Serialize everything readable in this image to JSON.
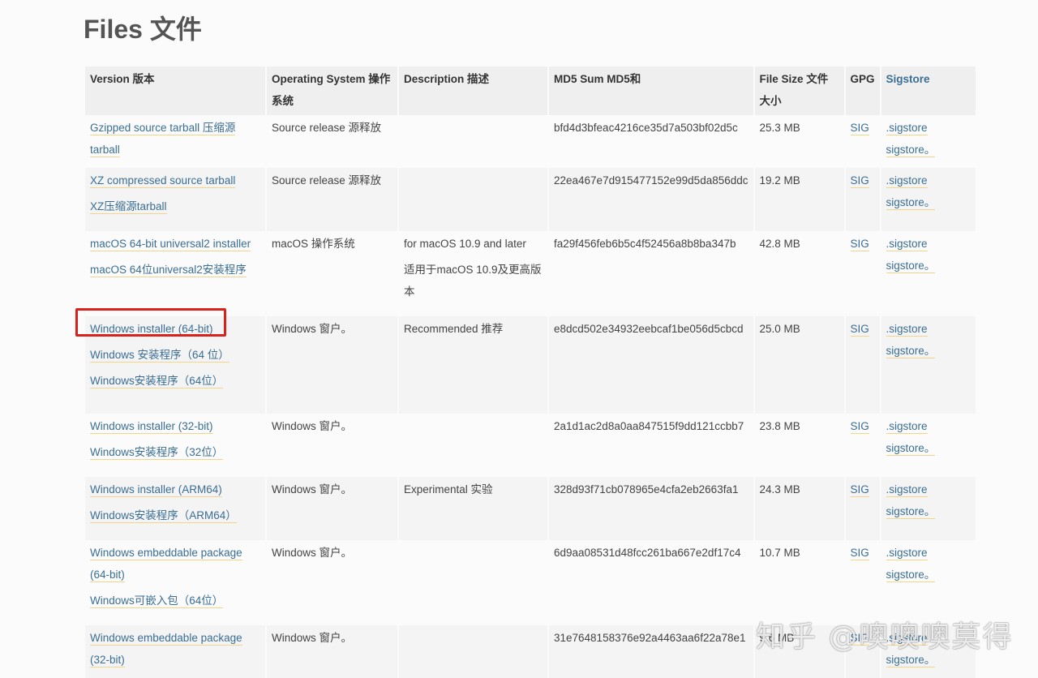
{
  "page": {
    "title": "Files  文件"
  },
  "table": {
    "headers": {
      "version": "Version 版本",
      "os": "Operating System 操作系统",
      "description": "Description 描述",
      "md5": "MD5 Sum MD5和",
      "size": "File Size 文件大小",
      "gpg": "GPG",
      "sigstore": "Sigstore"
    },
    "rows": [
      {
        "version": [
          "Gzipped source tarball 压缩源tarball"
        ],
        "os": "Source release 源释放",
        "description": [],
        "md5": "bfd4d3bfeac4216ce35d7a503bf02d5c",
        "size": "25.3 MB",
        "gpg": "SIG",
        "sigstore": [
          ".sigstore",
          "sigstore。"
        ]
      },
      {
        "version": [
          "XZ compressed source tarball",
          "XZ压缩源tarball"
        ],
        "os": "Source release 源释放",
        "description": [],
        "md5": "22ea467e7d915477152e99d5da856ddc",
        "size": "19.2 MB",
        "gpg": "SIG",
        "sigstore": [
          ".sigstore",
          "sigstore。"
        ]
      },
      {
        "version": [
          "macOS 64-bit universal2 installer",
          "macOS 64位universal2安装程序"
        ],
        "os": "macOS 操作系统",
        "description": [
          "for macOS 10.9 and later",
          "适用于macOS 10.9及更高版本"
        ],
        "md5": "fa29f456feb6b5c4f52456a8b8ba347b",
        "size": "42.8 MB",
        "gpg": "SIG",
        "sigstore": [
          ".sigstore",
          "sigstore。"
        ]
      },
      {
        "version": [
          "Windows installer (64-bit)",
          "Windows 安装程序（64 位）",
          "Windows安装程序（64位）"
        ],
        "os": "Windows 窗户。",
        "description": [
          "Recommended 推荐"
        ],
        "md5": "e8dcd502e34932eebcaf1be056d5cbcd",
        "size": "25.0 MB",
        "gpg": "SIG",
        "sigstore": [
          ".sigstore",
          "sigstore。"
        ]
      },
      {
        "version": [
          "Windows installer (32-bit)",
          "Windows安装程序（32位）"
        ],
        "os": "Windows 窗户。",
        "description": [],
        "md5": "2a1d1ac2d8a0aa847515f9dd121ccbb7",
        "size": "23.8 MB",
        "gpg": "SIG",
        "sigstore": [
          ".sigstore",
          "sigstore。"
        ]
      },
      {
        "version": [
          "Windows installer (ARM64)",
          "Windows安装程序（ARM64）"
        ],
        "os": "Windows 窗户。",
        "description": [
          "Experimental 实验"
        ],
        "md5": "328d93f71cb078965e4cfa2eb2663fa1",
        "size": "24.3 MB",
        "gpg": "SIG",
        "sigstore": [
          ".sigstore",
          "sigstore。"
        ]
      },
      {
        "version": [
          "Windows embeddable package (64-bit)",
          "Windows可嵌入包（64位）"
        ],
        "os": "Windows 窗户。",
        "description": [],
        "md5": "6d9aa08531d48fcc261ba667e2df17c4",
        "size": "10.7 MB",
        "gpg": "SIG",
        "sigstore": [
          ".sigstore",
          "sigstore。"
        ]
      },
      {
        "version": [
          "Windows embeddable package (32-bit)"
        ],
        "os": "Windows 窗户。",
        "description": [],
        "md5": "31e7648158376e92a4463aa6f22a78e1",
        "size": "9.6 MB",
        "gpg": "SIG",
        "sigstore": [
          ".sigstore",
          "sigstore。"
        ]
      }
    ]
  },
  "watermark": "知乎 @噢噢噢莫得",
  "colors": {
    "link": "#3a6e94",
    "underline": "#f2d48a",
    "highlight": "#d9221c"
  }
}
